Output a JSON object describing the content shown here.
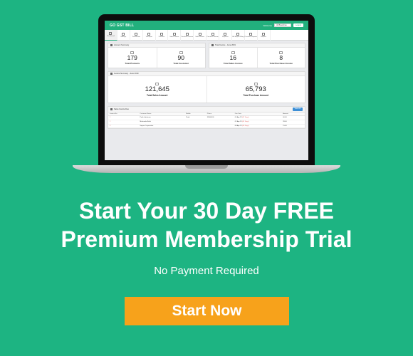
{
  "app": {
    "logo": "GO GST BILL",
    "top_label": "Welcome",
    "select_value": "All Branches",
    "top_button": "Logout"
  },
  "nav": [
    {
      "label": "Dashboard",
      "icon": "home-icon",
      "active": true
    },
    {
      "label": "Settings",
      "icon": "gear-icon"
    },
    {
      "label": "Transaction",
      "icon": "transaction-icon"
    },
    {
      "label": "Transport",
      "icon": "truck-icon"
    },
    {
      "label": "Products",
      "icon": "box-icon"
    },
    {
      "label": "Sales Invoice",
      "icon": "invoice-icon"
    },
    {
      "label": "Purchase Invoice",
      "icon": "cart-icon"
    },
    {
      "label": "Sales Return",
      "icon": "return-icon"
    },
    {
      "label": "Purchase Return",
      "icon": "return-icon"
    },
    {
      "label": "Expense",
      "icon": "wallet-icon"
    },
    {
      "label": "Bill Report Filing",
      "icon": "file-icon"
    },
    {
      "label": "Purchase Reports",
      "icon": "chart-icon"
    },
    {
      "label": "Reports",
      "icon": "report-icon"
    }
  ],
  "account_summary": {
    "title": "Account Summary",
    "stats": [
      {
        "value": "179",
        "label": "Total Products",
        "icon": "box-icon"
      },
      {
        "value": "90",
        "label": "Total Customer",
        "icon": "user-icon"
      }
    ]
  },
  "total_invoice": {
    "title": "Total Invoice - June 2019",
    "stats": [
      {
        "value": "16",
        "label": "Total Sales Invoice",
        "icon": "printer-icon"
      },
      {
        "value": "8",
        "label": "Total Purchase Invoice",
        "icon": "printer-icon"
      }
    ]
  },
  "invoice_summary": {
    "title": "Invoice Summary - June 2019",
    "stats": [
      {
        "value": "121,645",
        "label": "Total Sales Amount",
        "icon": "cash-icon"
      },
      {
        "value": "65,793",
        "label": "Total Purchase Amount",
        "icon": "cash-icon"
      }
    ]
  },
  "sales_due": {
    "title": "Sales Invoice Due",
    "view_all": "View All",
    "headers": [
      "Invoice No.",
      "Customer Name",
      "Mobile",
      "Phone",
      "Due Date",
      "Amount"
    ],
    "rows": [
      {
        "invoice": "1",
        "customer": "Parth Industries",
        "mobile": "Parth",
        "phone": "33000000",
        "due": "01-Apr-19",
        "due_tag": "(67 Days)",
        "amount": "60.00"
      },
      {
        "invoice": "2",
        "customer": "Mahendra Bothi",
        "mobile": "",
        "phone": "",
        "due": "07-Apr-19",
        "due_tag": "(61 Days)",
        "amount": "28.00"
      },
      {
        "invoice": "3",
        "customer": "Sayam Corporation",
        "mobile": "",
        "phone": "",
        "due": "08-Apr-19",
        "due_tag": "(60 Days)",
        "amount": "15.00"
      }
    ]
  },
  "promo": {
    "headline_line1": "Start Your 30 Day FREE",
    "headline_line2": "Premium Membership Trial",
    "subtext": "No Payment Required",
    "cta": "Start Now"
  },
  "colors": {
    "background": "#1db482",
    "cta": "#f7a21b",
    "app_header": "#22b07d"
  }
}
